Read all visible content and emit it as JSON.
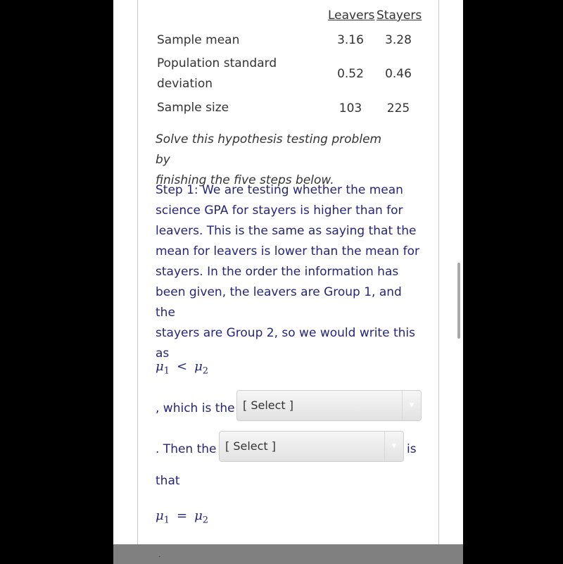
{
  "table": {
    "headers": [
      "Leavers",
      "Stayers"
    ],
    "rows": [
      {
        "label": "Sample mean",
        "leavers": "3.16",
        "stayers": "3.28"
      },
      {
        "label_line1": "Population standard",
        "label_line2": "deviation",
        "leavers": "0.52",
        "stayers": "0.46"
      },
      {
        "label": "Sample size",
        "leavers": "103",
        "stayers": "225"
      }
    ]
  },
  "intro": {
    "line1": "Solve this hypothesis testing problem by",
    "line2": "finishing the five steps below."
  },
  "step1": {
    "lines": [
      "Step 1: We are testing whether the mean",
      "science GPA for stayers is higher than for",
      "leavers. This is the same as saying that the",
      "mean for leavers is lower than the mean for",
      "stayers. In the order the information has",
      "been given, the leavers are Group 1, and the",
      "stayers are Group 2, so we would write this",
      "as"
    ],
    "alt_hypothesis": {
      "lhs": "μ",
      "lhs_sub": "1",
      "op": "<",
      "rhs": "μ",
      "rhs_sub": "2"
    },
    "which_is_the": ", which is the",
    "select1": {
      "value": "[ Select ]"
    },
    "then_the": ". Then the",
    "select2": {
      "value": "[ Select ]"
    },
    "is": "is",
    "that": "that",
    "null_hypothesis": {
      "lhs": "μ",
      "lhs_sub": "1",
      "op": "=",
      "rhs": "μ",
      "rhs_sub": "2"
    },
    "trailing": "."
  }
}
